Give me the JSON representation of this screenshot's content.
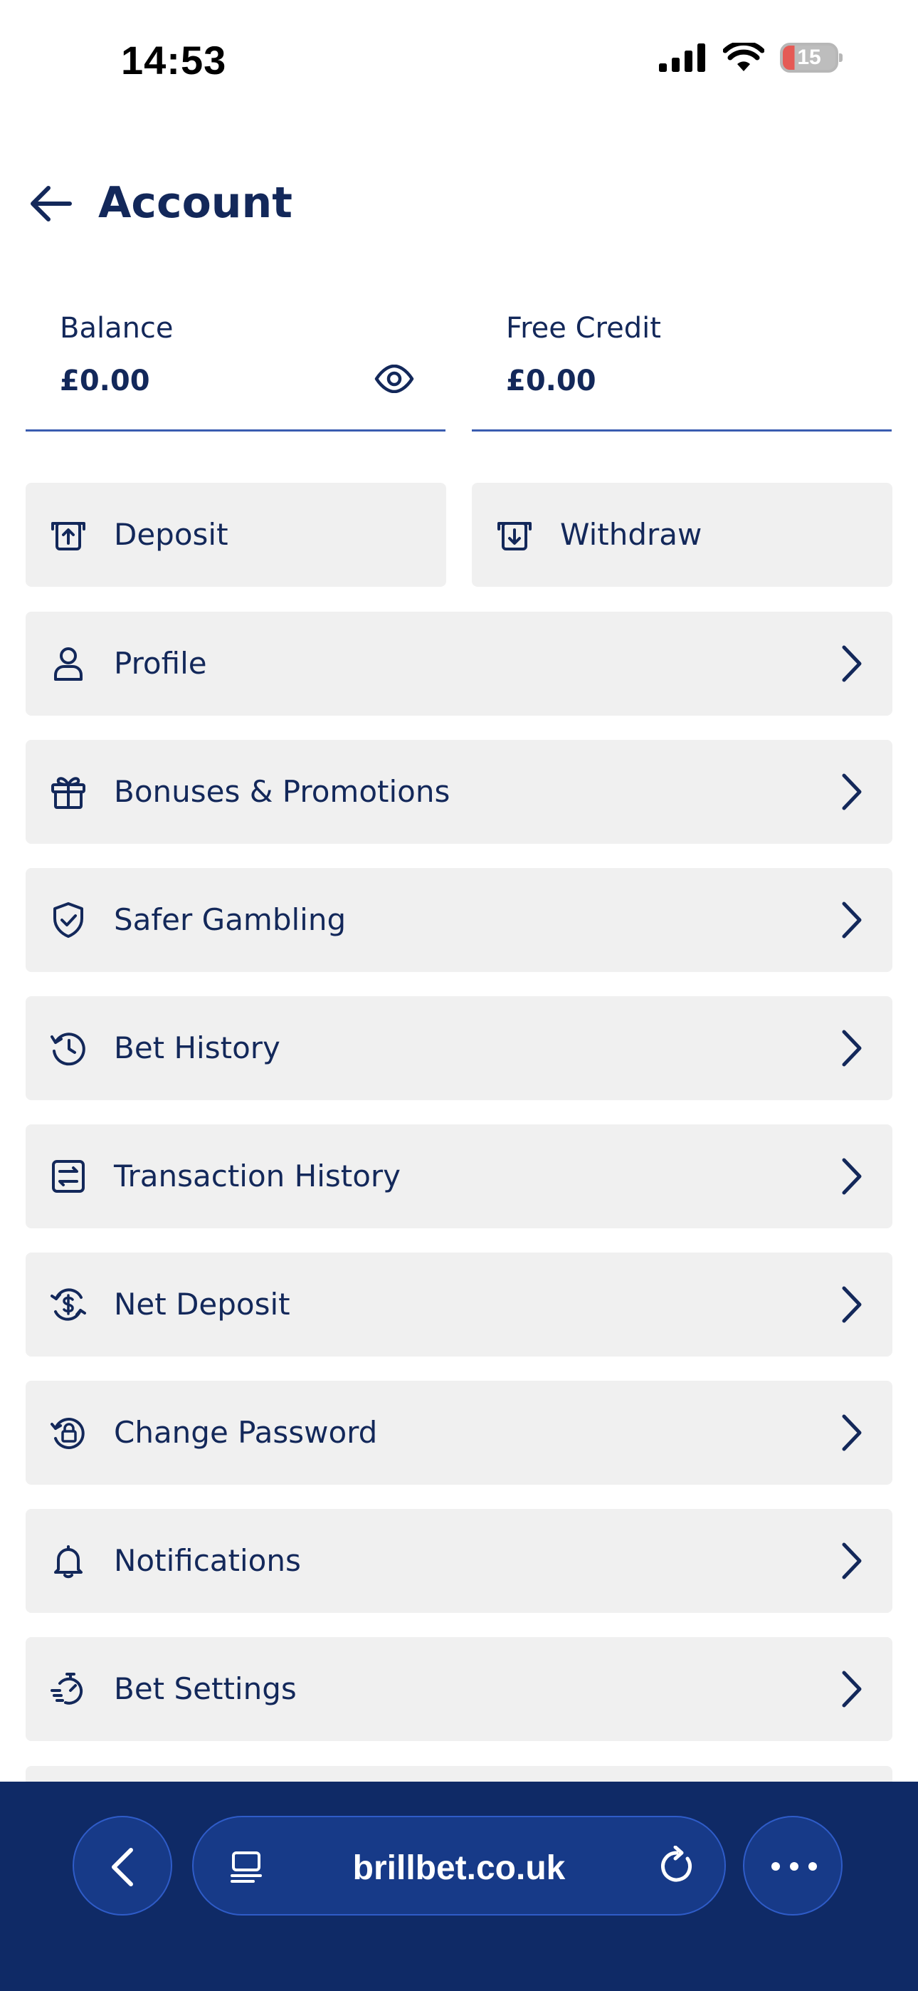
{
  "status_bar": {
    "time": "14:53",
    "battery_level": "15",
    "icons": [
      "signal-icon",
      "wifi-icon",
      "battery-icon"
    ]
  },
  "header": {
    "title": "Account",
    "back_icon": "arrow-left-icon"
  },
  "balances": {
    "balance": {
      "label": "Balance",
      "value": "£0.00",
      "icon": "eye-icon"
    },
    "free_credit": {
      "label": "Free Credit",
      "value": "£0.00"
    }
  },
  "actions": {
    "deposit": {
      "label": "Deposit",
      "icon": "deposit-icon"
    },
    "withdraw": {
      "label": "Withdraw",
      "icon": "withdraw-icon"
    }
  },
  "menu": [
    {
      "label": "Profile",
      "icon": "user-icon"
    },
    {
      "label": "Bonuses & Promotions",
      "icon": "gift-icon"
    },
    {
      "label": "Safer Gambling",
      "icon": "shield-check-icon"
    },
    {
      "label": "Bet History",
      "icon": "history-icon"
    },
    {
      "label": "Transaction History",
      "icon": "transactions-icon"
    },
    {
      "label": "Net Deposit",
      "icon": "money-cycle-icon"
    },
    {
      "label": "Change Password",
      "icon": "lock-reset-icon"
    },
    {
      "label": "Notifications",
      "icon": "bell-icon"
    },
    {
      "label": "Bet Settings",
      "icon": "timer-settings-icon"
    }
  ],
  "browser": {
    "url": "brillbet.co.uk",
    "icons": [
      "back-chevron-icon",
      "tabs-icon",
      "reload-icon",
      "more-icon"
    ]
  },
  "colors": {
    "text": "#13285a",
    "row_background": "#f0f0f0",
    "underline": "#3a5cb0",
    "browser_bar": "#0f2a66",
    "browser_button": "#173a88"
  }
}
